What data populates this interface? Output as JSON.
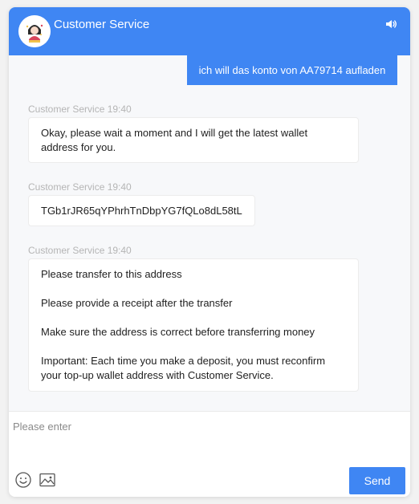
{
  "header": {
    "title": "Customer Service",
    "avatar_icon": "agent-avatar-icon",
    "sound_icon": "speaker-icon",
    "accent_color": "#3f86f3"
  },
  "messages": [
    {
      "direction": "outgoing",
      "text": "ich will das konto von AA79714 aufladen"
    },
    {
      "direction": "incoming",
      "sender": "Customer Service",
      "time": "19:40",
      "meta": "Customer Service 19:40",
      "paragraphs": [
        "Okay, please wait a moment and I will get the latest wallet address for you."
      ]
    },
    {
      "direction": "incoming",
      "sender": "Customer Service",
      "time": "19:40",
      "meta": "Customer Service 19:40",
      "paragraphs": [
        "TGb1rJR65qYPhrhTnDbpYG7fQLo8dL58tL"
      ]
    },
    {
      "direction": "incoming",
      "sender": "Customer Service",
      "time": "19:40",
      "meta": "Customer Service 19:40",
      "paragraphs": [
        "Please transfer to this address",
        "Please provide a receipt after the transfer",
        "Make sure the address is correct before transferring money",
        "Important: Each time you make a deposit, you must reconfirm your top-up wallet address with Customer Service."
      ]
    }
  ],
  "composer": {
    "placeholder": "Please enter",
    "value": "",
    "emoji_icon": "emoji-icon",
    "image_icon": "image-icon",
    "send_label": "Send"
  }
}
